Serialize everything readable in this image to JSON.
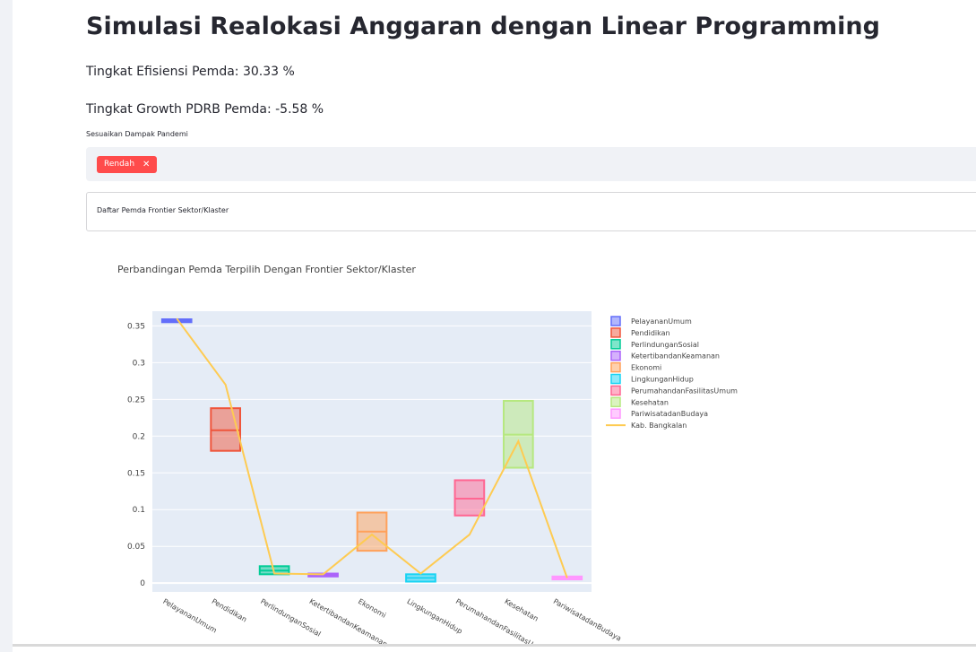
{
  "header": {
    "title": "Simulasi Realokasi Anggaran dengan Linear Programming",
    "efisiensi": "Tingkat Efisiensi Pemda: 30.33 %",
    "growth": "Tingkat Growth PDRB Pemda: -5.58 %"
  },
  "pandemi_select": {
    "label": "Sesuaikan Dampak Pandemi",
    "selected_tag": "Rendah",
    "remove_glyph": "✕",
    "tag_color": "#ff4b4b"
  },
  "expander": {
    "label": "Daftar Pemda Frontier Sektor/Klaster"
  },
  "chart_data": {
    "type": "box",
    "title": "Perbandingan Pemda Terpilih Dengan Frontier Sektor/Klaster",
    "xlabel": "",
    "ylabel": "",
    "yticks": [
      "0",
      "0.05",
      "0.1",
      "0.15",
      "0.2",
      "0.25",
      "0.3",
      "0.35"
    ],
    "ylim": [
      -0.012,
      0.37
    ],
    "grid": true,
    "legend_position": "right",
    "categories": [
      "PelayananUmum",
      "Pendidikan",
      "PerlindunganSosial",
      "KetertibandanKeamanan",
      "Ekonomi",
      "LingkunganHidup",
      "PerumahandanFasilitasUmum",
      "Kesehatan",
      "PariwisatadanBudaya"
    ],
    "tick_labels": [
      "PelayananUmum",
      "Pendidikan",
      "PerlindunganSosial",
      "KetertibandanKeamanan",
      "Ekonomi",
      "LingkunganHidup",
      "PerumahandanFasilitasU",
      "Kesehatan",
      "PariwisatadanBudaya"
    ],
    "boxes": [
      {
        "name": "PelayananUmum",
        "q1": 0.355,
        "median": 0.357,
        "q3": 0.359,
        "color": "#636efa"
      },
      {
        "name": "Pendidikan",
        "q1": 0.18,
        "median": 0.208,
        "q3": 0.238,
        "color": "#ef553b"
      },
      {
        "name": "PerlindunganSosial",
        "q1": 0.012,
        "median": 0.017,
        "q3": 0.023,
        "color": "#00cc96"
      },
      {
        "name": "KetertibandanKeamanan",
        "q1": 0.009,
        "median": 0.011,
        "q3": 0.013,
        "color": "#ab63fa"
      },
      {
        "name": "Ekonomi",
        "q1": 0.044,
        "median": 0.07,
        "q3": 0.096,
        "color": "#ffa15a"
      },
      {
        "name": "LingkunganHidup",
        "q1": 0.002,
        "median": 0.007,
        "q3": 0.012,
        "color": "#19d3f3"
      },
      {
        "name": "PerumahandanFasilitasUmum",
        "q1": 0.092,
        "median": 0.115,
        "q3": 0.14,
        "color": "#ff6692"
      },
      {
        "name": "Kesehatan",
        "q1": 0.157,
        "median": 0.202,
        "q3": 0.248,
        "color": "#b6e880"
      },
      {
        "name": "PariwisatadanBudaya",
        "q1": 0.005,
        "median": 0.007,
        "q3": 0.009,
        "color": "#ff97ff"
      }
    ],
    "line_series": {
      "name": "Kab. Bangkalan",
      "color": "#fecb52",
      "values": [
        0.36,
        0.27,
        0.013,
        0.012,
        0.066,
        0.013,
        0.066,
        0.193,
        0.007
      ]
    }
  }
}
